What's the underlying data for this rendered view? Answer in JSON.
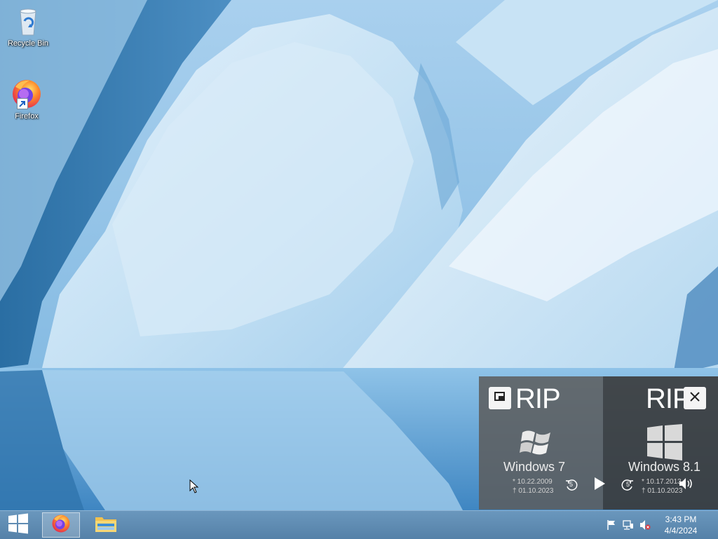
{
  "desktop": {
    "icons": [
      {
        "label": "Recycle Bin",
        "icon": "recycle-bin-icon"
      },
      {
        "label": "Firefox",
        "icon": "firefox-icon"
      }
    ]
  },
  "taskbar": {
    "start_icon": "windows-start-icon",
    "apps": [
      {
        "name": "Firefox",
        "icon": "firefox-icon",
        "active": true
      },
      {
        "name": "File Explorer",
        "icon": "file-explorer-icon",
        "active": false
      }
    ],
    "tray_icons": [
      "action-center-flag-icon",
      "network-icon",
      "volume-muted-icon"
    ],
    "clock": {
      "time": "3:43 PM",
      "date": "4/4/2024"
    }
  },
  "rip_widget": {
    "left": {
      "title": "RIP",
      "os_name": "Windows 7",
      "born": "* 10.22.2009",
      "died": "† 01.10.2023"
    },
    "right": {
      "title": "RIP",
      "os_name": "Windows 8.1",
      "born": "* 10.17.2013",
      "died": "† 01.10.2023"
    },
    "controls": {
      "rewind_label": "5",
      "forward_label": "5"
    }
  },
  "colors": {
    "taskbar": "#5f8bb3",
    "rip_left_panel": "#5c5c5c",
    "rip_right_panel": "#3a3a3a",
    "ice_light": "#cfe6f6",
    "ice_dark": "#1f5f93"
  }
}
